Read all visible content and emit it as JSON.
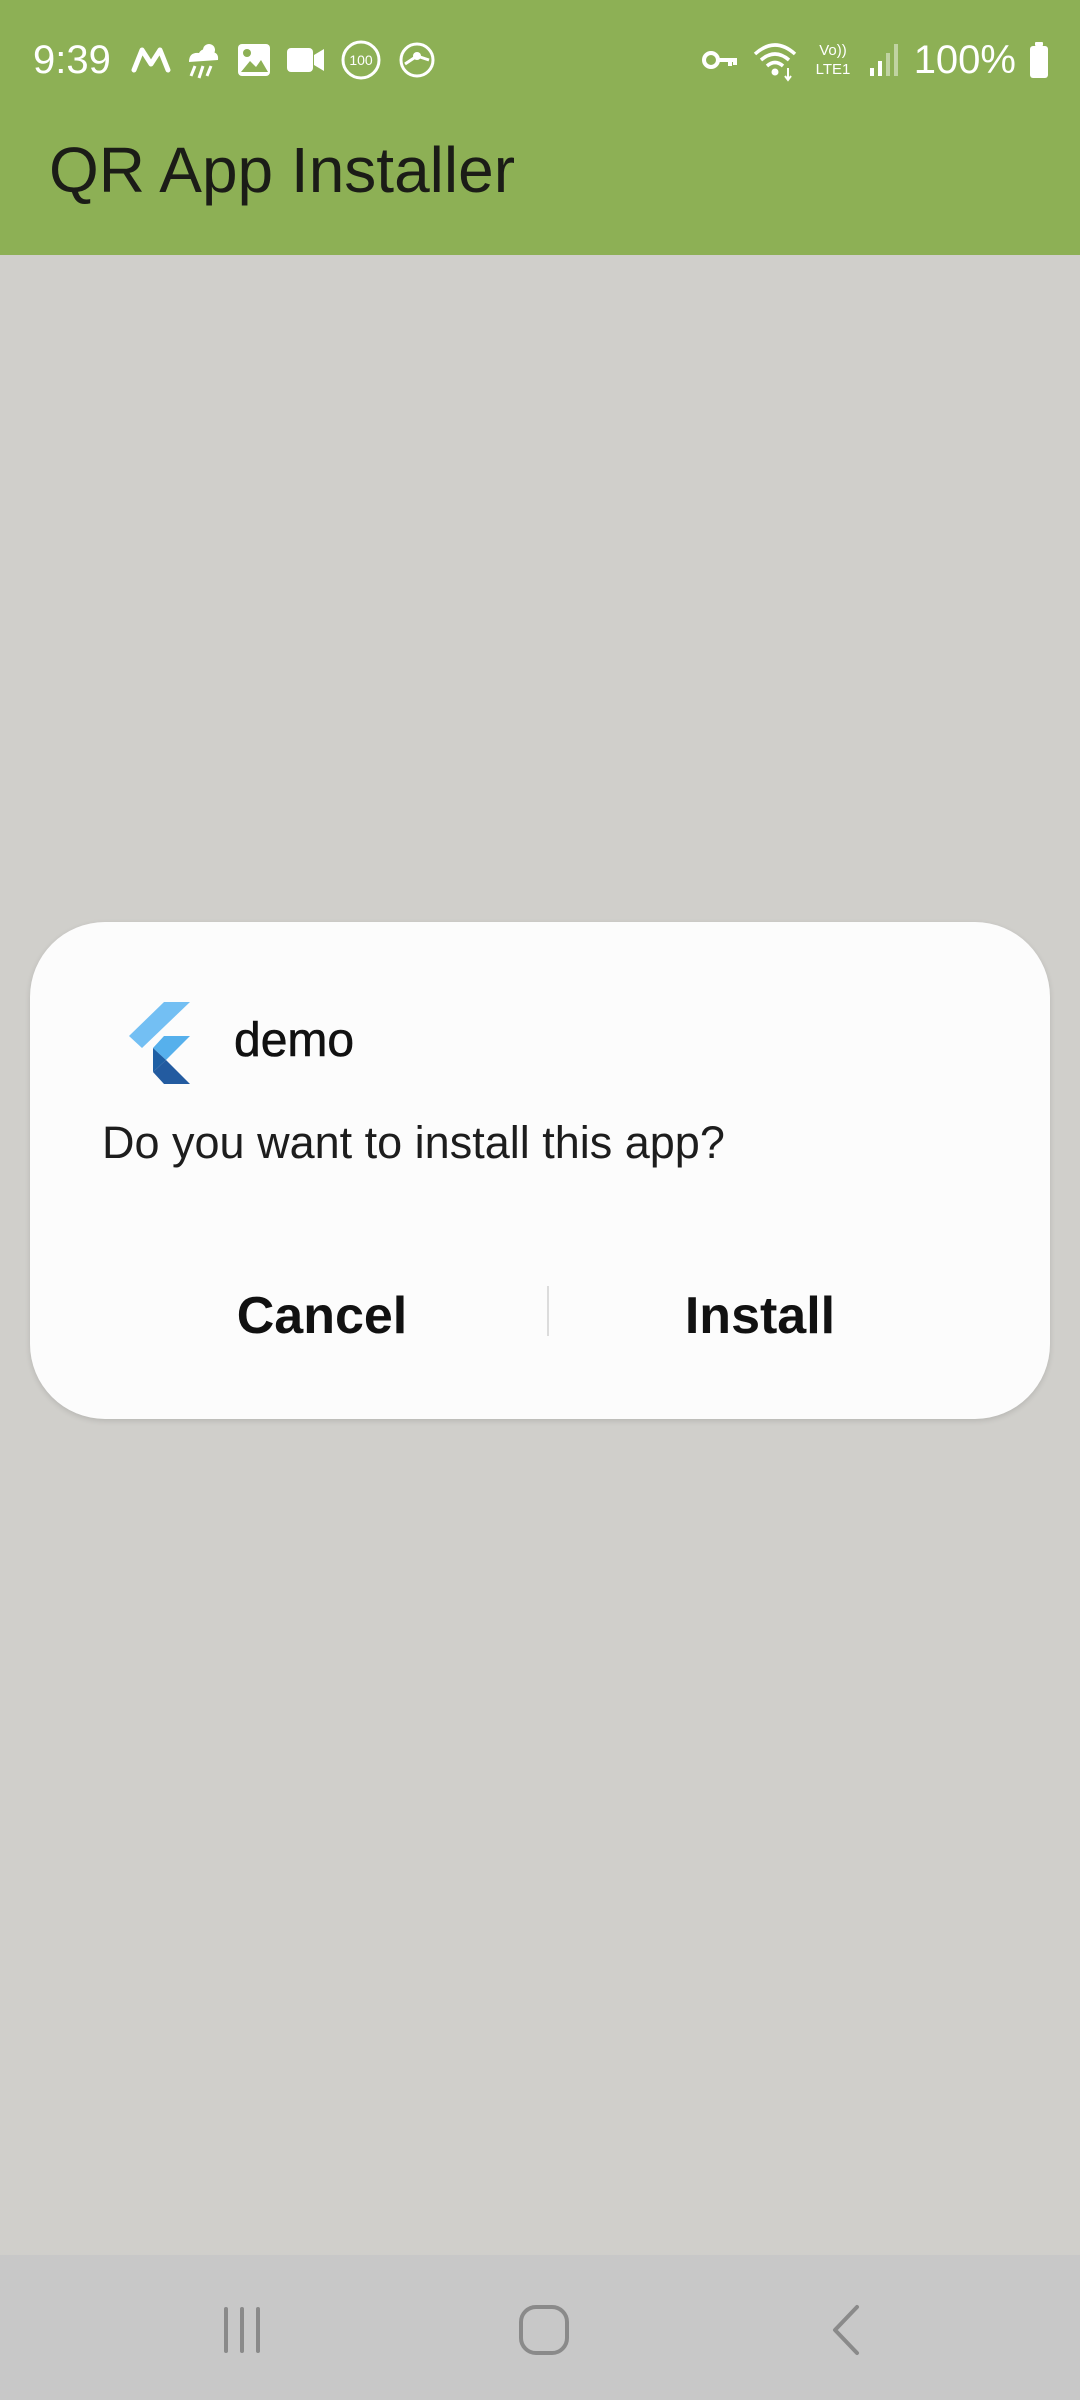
{
  "status_bar": {
    "time": "9:39",
    "battery": "100%",
    "left_icons": [
      "m-logo-icon",
      "weather-icon",
      "gallery-icon",
      "video-icon",
      "counter-100-icon",
      "sync-icon"
    ],
    "right_icons": [
      "vpn-key-icon",
      "wifi-icon",
      "volte-icon",
      "signal-icon",
      "battery-icon"
    ],
    "counter_badge": "100",
    "volte_top": "Vo))",
    "volte_bottom": "LTE1"
  },
  "app_bar": {
    "title": "QR App Installer"
  },
  "dialog": {
    "app_name": "demo",
    "message": "Do you want to install this app?",
    "cancel_label": "Cancel",
    "install_label": "Install"
  },
  "nav_bar": {
    "buttons": [
      "recents-icon",
      "home-icon",
      "back-icon"
    ]
  },
  "colors": {
    "app_bar": "#8db055",
    "background": "#d0cfcb",
    "dialog": "#fcfcfc",
    "nav_bar": "#c8c8c8"
  }
}
